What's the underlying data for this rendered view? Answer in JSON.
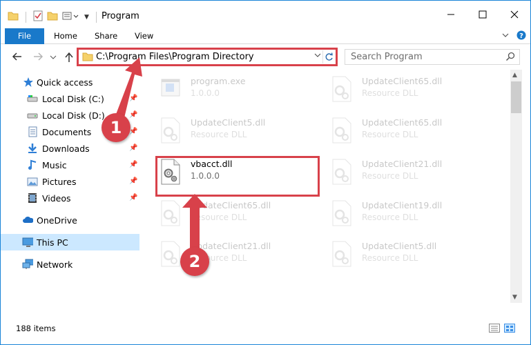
{
  "title": "Program",
  "ribbon": {
    "tabs": [
      {
        "label": "File"
      },
      {
        "label": "Home"
      },
      {
        "label": "Share"
      },
      {
        "label": "View"
      }
    ]
  },
  "address": {
    "path": "C:\\Program Files\\Program Directory"
  },
  "search": {
    "placeholder": "Search Program"
  },
  "sidebar": {
    "items": [
      {
        "label": "Quick access",
        "icon": "star-icon"
      },
      {
        "label": "Local Disk (C:)",
        "icon": "drive-icon",
        "pinned": true
      },
      {
        "label": "Local Disk (D:)",
        "icon": "drive-icon",
        "pinned": true
      },
      {
        "label": "Documents",
        "icon": "documents-icon",
        "pinned": true
      },
      {
        "label": "Downloads",
        "icon": "downloads-icon",
        "pinned": true
      },
      {
        "label": "Music",
        "icon": "music-icon",
        "pinned": true
      },
      {
        "label": "Pictures",
        "icon": "pictures-icon",
        "pinned": true
      },
      {
        "label": "Videos",
        "icon": "videos-icon",
        "pinned": true
      },
      {
        "label": "OneDrive",
        "icon": "onedrive-icon"
      },
      {
        "label": "This PC",
        "icon": "this-pc-icon",
        "selected": true
      },
      {
        "label": "Network",
        "icon": "network-icon"
      }
    ]
  },
  "files": [
    {
      "name": "program.exe",
      "desc": "1.0.0.0",
      "faded": true
    },
    {
      "name": "UpdateClient65.dll",
      "desc": "Resource DLL",
      "faded": true
    },
    {
      "name": "UpdateClient5.dll",
      "desc": "Resource DLL",
      "faded": true
    },
    {
      "name": "UpdateClient65.dll",
      "desc": "Resource DLL",
      "faded": true
    },
    {
      "name": "vbacct.dll",
      "desc": "1.0.0.0",
      "faded": false
    },
    {
      "name": "UpdateClient21.dll",
      "desc": "Resource DLL",
      "faded": true
    },
    {
      "name": "UpdateClient65.dll",
      "desc": "Resource DLL",
      "faded": true
    },
    {
      "name": "UpdateClient19.dll",
      "desc": "Resource DLL",
      "faded": true
    },
    {
      "name": "UpdateClient21.dll",
      "desc": "Resource DLL",
      "faded": true
    },
    {
      "name": "UpdateClient5.dll",
      "desc": "Resource DLL",
      "faded": true
    }
  ],
  "status": {
    "item_count": "188 items"
  },
  "callouts": {
    "one": "1",
    "two": "2"
  },
  "colors": {
    "accent": "#1979ca",
    "highlight": "#d8414a",
    "selected_bg": "#cce8ff"
  }
}
